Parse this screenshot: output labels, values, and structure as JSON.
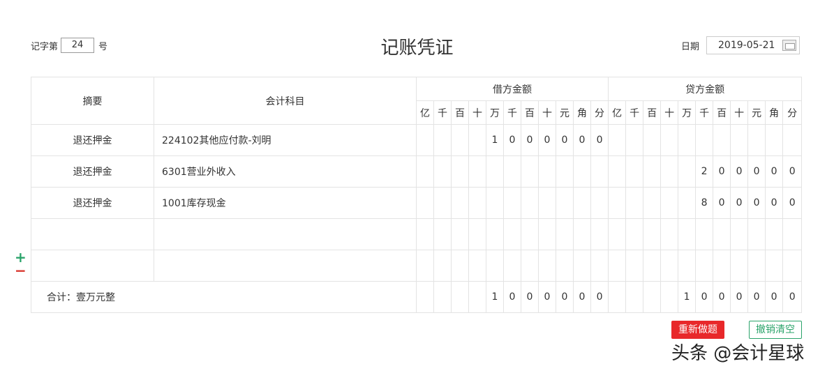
{
  "header": {
    "voucher_prefix": "记字第",
    "voucher_number": "24",
    "voucher_suffix": "号",
    "title": "记账凭证",
    "date_label": "日期",
    "date_value": "2019-05-21"
  },
  "table": {
    "col_summary": "摘要",
    "col_account": "会计科目",
    "debit_title": "借方金额",
    "credit_title": "贷方金额",
    "digit_labels": [
      "亿",
      "千",
      "百",
      "十",
      "万",
      "千",
      "百",
      "十",
      "元",
      "角",
      "分"
    ],
    "rows": [
      {
        "summary": "退还押金",
        "account": "224102其他应付款-刘明",
        "debit": [
          "",
          "",
          "",
          "",
          "1",
          "0",
          "0",
          "0",
          "0",
          "0",
          "0"
        ],
        "credit": [
          "",
          "",
          "",
          "",
          "",
          "",
          "",
          "",
          "",
          "",
          ""
        ]
      },
      {
        "summary": "退还押金",
        "account": "6301营业外收入",
        "debit": [
          "",
          "",
          "",
          "",
          "",
          "",
          "",
          "",
          "",
          "",
          ""
        ],
        "credit": [
          "",
          "",
          "",
          "",
          "",
          "2",
          "0",
          "0",
          "0",
          "0",
          "0"
        ]
      },
      {
        "summary": "退还押金",
        "account": "1001库存现金",
        "debit": [
          "",
          "",
          "",
          "",
          "",
          "",
          "",
          "",
          "",
          "",
          ""
        ],
        "credit": [
          "",
          "",
          "",
          "",
          "",
          "8",
          "0",
          "0",
          "0",
          "0",
          "0"
        ]
      },
      {
        "summary": "",
        "account": "",
        "debit": [
          "",
          "",
          "",
          "",
          "",
          "",
          "",
          "",
          "",
          "",
          ""
        ],
        "credit": [
          "",
          "",
          "",
          "",
          "",
          "",
          "",
          "",
          "",
          "",
          ""
        ]
      },
      {
        "summary": "",
        "account": "",
        "debit": [
          "",
          "",
          "",
          "",
          "",
          "",
          "",
          "",
          "",
          "",
          ""
        ],
        "credit": [
          "",
          "",
          "",
          "",
          "",
          "",
          "",
          "",
          "",
          "",
          ""
        ]
      }
    ],
    "total_label": "合计：壹万元整",
    "total_debit": [
      "",
      "",
      "",
      "",
      "1",
      "0",
      "0",
      "0",
      "0",
      "0",
      "0"
    ],
    "total_credit": [
      "",
      "",
      "",
      "",
      "1",
      "0",
      "0",
      "0",
      "0",
      "0",
      "0"
    ]
  },
  "side_controls": {
    "add": "+",
    "remove": "−"
  },
  "buttons": {
    "redo": "重新做题",
    "clear": "撤销清空"
  },
  "watermark": "头条 @会计星球",
  "colors": {
    "add": "#2aa36a",
    "remove": "#d9342b",
    "redo_bg": "#e8282a",
    "clear_border": "#2aa36a"
  }
}
